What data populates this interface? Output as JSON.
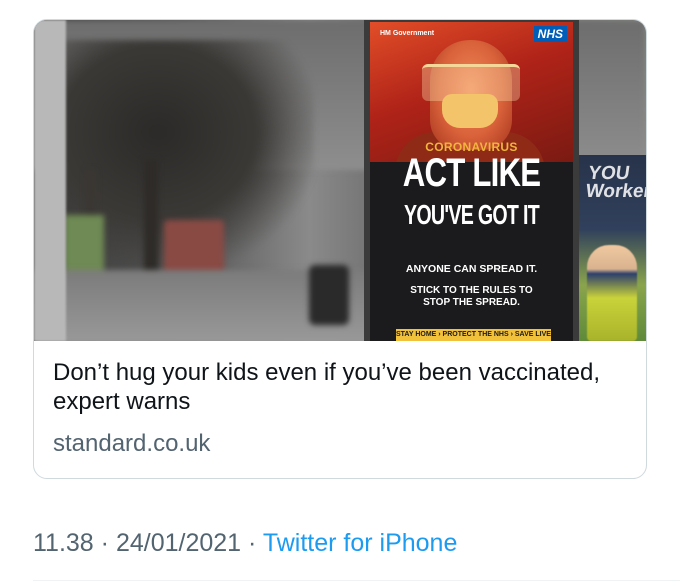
{
  "card": {
    "image_alt": "NHS coronavirus bus stop advertisement",
    "poster": {
      "gov_logo": "HM Government",
      "nhs_badge": "NHS",
      "kicker": "CORONAVIRUS",
      "headline_line1": "ACT LIKE",
      "headline_line2": "YOU'VE GOT IT",
      "body_line1": "ANYONE CAN SPREAD IT.",
      "body_line2": "STICK TO THE RULES TO",
      "body_line3": "STOP THE SPREAD.",
      "strip": "STAY HOME › PROTECT THE NHS › SAVE LIVES"
    },
    "side_poster_text": "YOU Workers",
    "title": "Don’t hug your kids even if you’ve been vaccinated, expert warns",
    "domain": "standard.co.uk"
  },
  "tweet_meta": {
    "time": "11.38",
    "separator": " · ",
    "date": "24/01/2021",
    "source": "Twitter for iPhone"
  },
  "colors": {
    "nhs_blue": "#005eb8",
    "link_blue": "#1d9bf0",
    "secondary_text": "#536471",
    "poster_yellow": "#f2c13b"
  }
}
